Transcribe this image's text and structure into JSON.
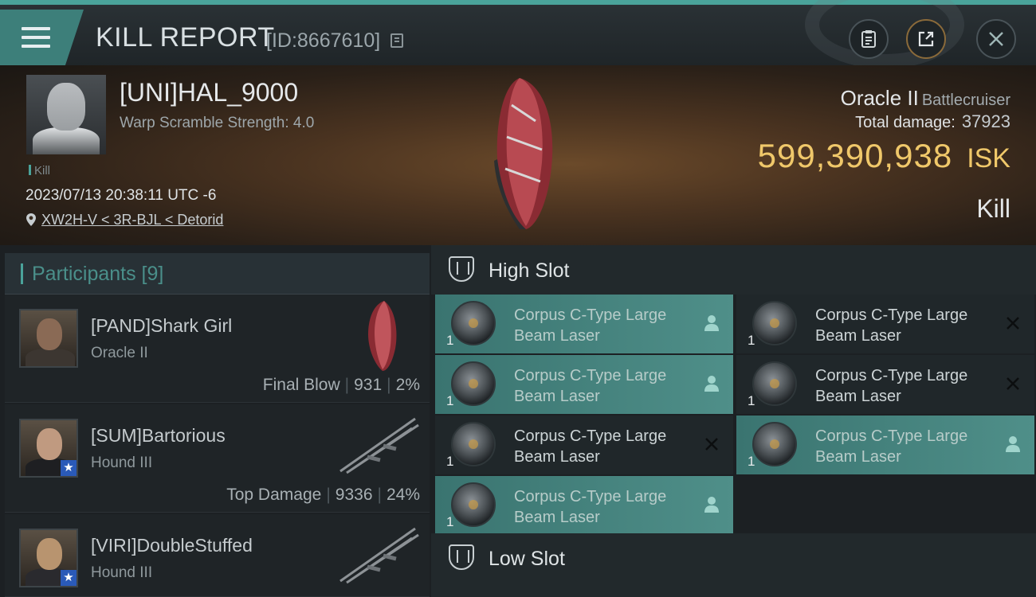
{
  "header": {
    "title": "KILL REPORT",
    "id_label": "[ID:8667610]"
  },
  "victim": {
    "name": "[UNI]HAL_9000",
    "warp": "Warp Scramble Strength: 4.0",
    "tag": "Kill",
    "timestamp": "2023/07/13 20:38:11 UTC -6",
    "location": "XW2H-V < 3R-BJL < Detorid",
    "ship": "Oracle II",
    "ship_class": "Battlecruiser",
    "damage_label": "Total damage:",
    "damage_value": "37923",
    "isk_amount": "599,390,938",
    "isk_currency": "ISK",
    "result": "Kill"
  },
  "participants": {
    "label": "Participants [9]",
    "rows": [
      {
        "name": "[PAND]Shark Girl",
        "ship": "Oracle II",
        "role": "Final Blow",
        "damage": "931",
        "percent": "2%"
      },
      {
        "name": "[SUM]Bartorious",
        "ship": "Hound III",
        "role": "Top Damage",
        "damage": "9336",
        "percent": "24%"
      },
      {
        "name": "[VIRI]DoubleStuffed",
        "ship": "Hound III",
        "role": "",
        "damage": "",
        "percent": ""
      }
    ]
  },
  "slots": {
    "high_label": "High Slot",
    "low_label": "Low Slot",
    "modules": [
      {
        "line1": "Corpus C-Type Large",
        "line2": "Beam Laser",
        "qty": "1",
        "status": "active"
      },
      {
        "line1": "Corpus C-Type Large",
        "line2": "Beam Laser",
        "qty": "1",
        "status": "destroyed"
      },
      {
        "line1": "Corpus C-Type Large",
        "line2": "Beam Laser",
        "qty": "1",
        "status": "active"
      },
      {
        "line1": "Corpus C-Type Large",
        "line2": "Beam Laser",
        "qty": "1",
        "status": "destroyed"
      },
      {
        "line1": "Corpus C-Type Large",
        "line2": "Beam Laser",
        "qty": "1",
        "status": "destroyed"
      },
      {
        "line1": "Corpus C-Type Large",
        "line2": "Beam Laser",
        "qty": "1",
        "status": "active"
      },
      {
        "line1": "Corpus C-Type Large",
        "line2": "Beam Laser",
        "qty": "1",
        "status": "active"
      }
    ]
  },
  "colors": {
    "accent": "#4aa39a",
    "isk": "#f0c86a",
    "active_module": "#4f8f89"
  },
  "icons": [
    "menu-icon",
    "copy-icon",
    "clipboard-icon",
    "share-icon",
    "close-icon",
    "location-pin-icon",
    "slot-icon",
    "pilot-icon",
    "destroyed-x-icon",
    "star-icon"
  ]
}
